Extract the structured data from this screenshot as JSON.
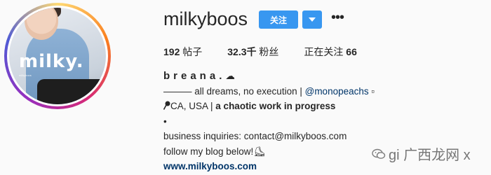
{
  "profile": {
    "avatar_brand": "milky.",
    "avatar_fineprint": "milkyboos",
    "username": "milkyboos",
    "follow_label": "关注",
    "dropdown_icon": "chevron-down-icon",
    "more_icon": "ellipsis-icon"
  },
  "stats": {
    "posts_count": "192",
    "posts_label": "帖子",
    "followers_count": "32.3千",
    "followers_label": "粉丝",
    "following_label": "正在关注",
    "following_count": "66"
  },
  "bio": {
    "display_name": "breana.",
    "cloud": "☁",
    "line1_text": "——— all dreams, no execution |",
    "line1_mention": "@monopeachs",
    "line1_tail": "▫",
    "line2_prefix": "CA, USA |",
    "line2_bold": "a chaotic work in progress",
    "line3": "•",
    "line4": "business inquiries: contact@milkyboos.com",
    "line5": "follow my blog below!",
    "line5_emoji": "⛸",
    "website": "www.milkyboos.com"
  },
  "watermark": {
    "text": "gi 广西龙网 x",
    "icon": "wechat-icon"
  },
  "colors": {
    "accent": "#3897f0",
    "link": "#003569",
    "text": "#262626",
    "background": "#fafafa"
  }
}
